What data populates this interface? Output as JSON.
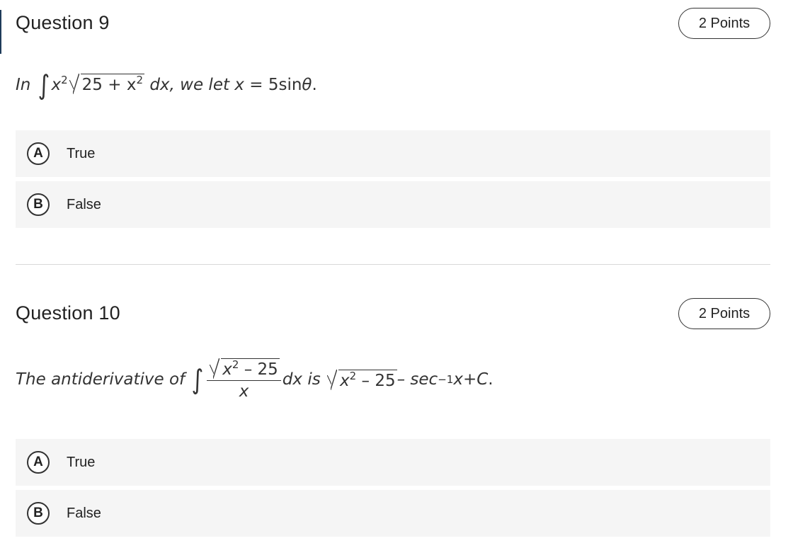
{
  "q9": {
    "title": "Question 9",
    "points": "2 Points",
    "stmt": {
      "in": "In",
      "integral": "∫",
      "x": "x",
      "exp2": "2",
      "radicand_a": "25 + x",
      "radicand_exp": "2",
      "dx": "dx",
      "rest": ", we let",
      "xeq": "x",
      "eq": "=",
      "rhs": "5sin",
      "theta": "θ",
      "period": "."
    },
    "options": [
      {
        "letter": "A",
        "label": "True"
      },
      {
        "letter": "B",
        "label": "False"
      }
    ]
  },
  "q10": {
    "title": "Question 10",
    "points": "2 Points",
    "stmt": {
      "lead": "The antiderivative of",
      "integral": "∫",
      "num_x": "x",
      "num_exp": "2",
      "num_rest": " – 25",
      "den": "x",
      "dxis": "dx is",
      "sq_x": "x",
      "sq_exp": "2",
      "sq_rest": " – 25",
      "minus": " – sec",
      "inv": "−1",
      "tail_x": "x",
      "tail_plus": " + ",
      "C": "C",
      "period": "."
    },
    "options": [
      {
        "letter": "A",
        "label": "True"
      },
      {
        "letter": "B",
        "label": "False"
      }
    ]
  }
}
